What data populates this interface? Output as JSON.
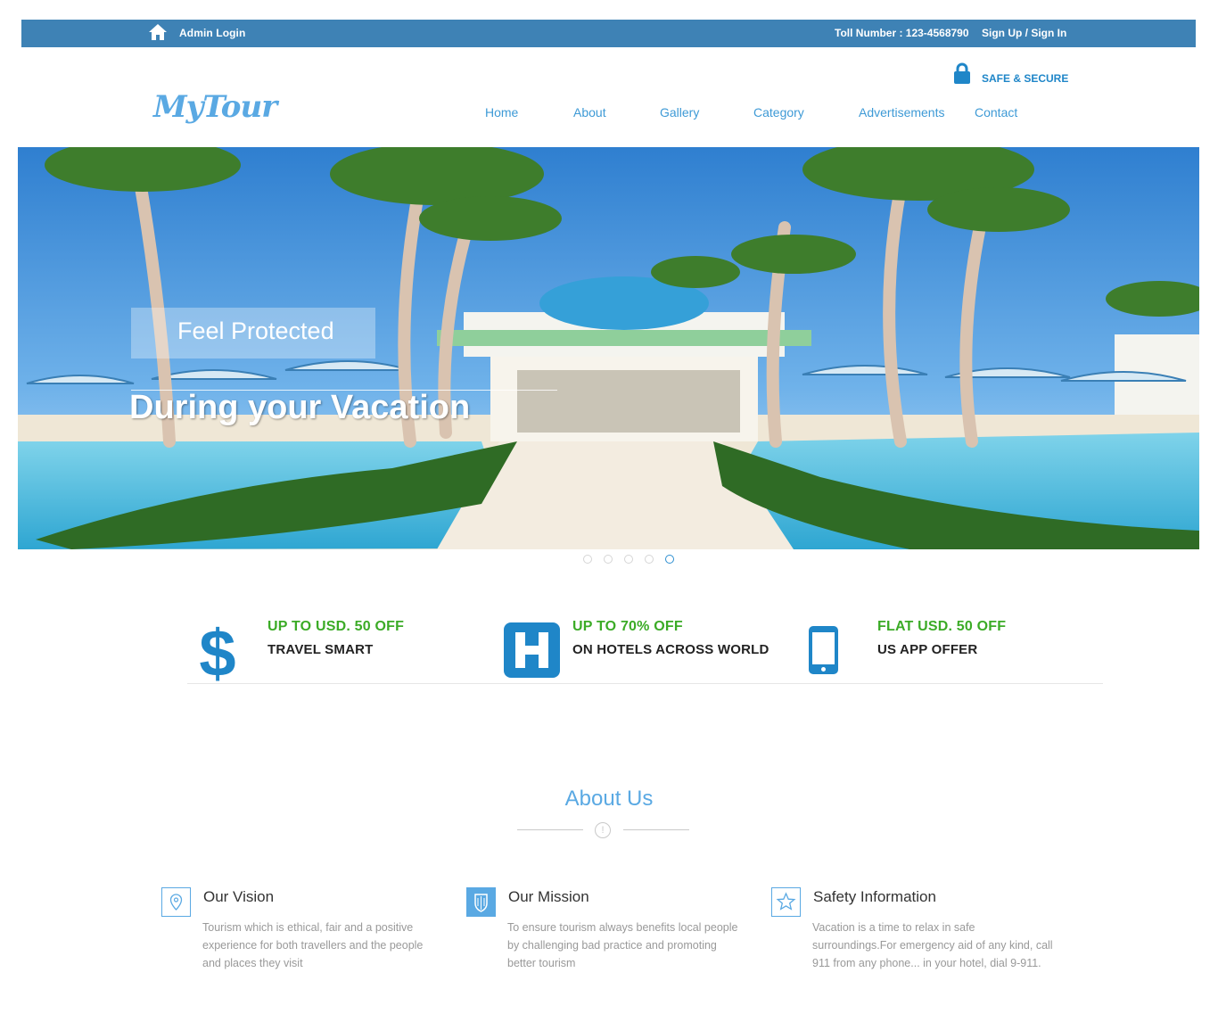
{
  "topbar": {
    "admin_label": "Admin Login",
    "toll": "Toll Number : 123-4568790",
    "sign": "Sign Up / Sign In",
    "bg_color": "#3e82b5"
  },
  "header": {
    "logo": "MyTour",
    "safe": "SAFE & SECURE",
    "nav": [
      "Home",
      "About",
      "Gallery",
      "Category",
      "Advertisements",
      "Contact"
    ]
  },
  "hero": {
    "caption_top": "Feel Protected",
    "caption_main": "During your Vacation",
    "slide_count": 5,
    "active_slide": 5
  },
  "offers": [
    {
      "title": "UP TO USD. 50 OFF",
      "subtitle": "TRAVEL SMART",
      "icon": "dollar-icon"
    },
    {
      "title": "UP TO 70% OFF",
      "subtitle": "ON HOTELS ACROSS WORLD",
      "icon": "hotel-icon"
    },
    {
      "title": "FLAT USD. 50 OFF",
      "subtitle": "US APP OFFER",
      "icon": "mobile-icon"
    }
  ],
  "about": {
    "title": "About Us",
    "features": [
      {
        "icon": "map-pin-icon",
        "heading": "Our Vision",
        "text": "Tourism which is ethical, fair and a positive experience for both travellers and the people and places they visit"
      },
      {
        "icon": "shield-icon",
        "heading": "Our Mission",
        "text": "To ensure tourism always benefits local people by challenging bad practice and promoting better tourism"
      },
      {
        "icon": "star-icon",
        "heading": "Safety Information",
        "text": "Vacation is a time to relax in safe surroundings.For emergency aid of any kind, call 911 from any phone... in your hotel, dial 9-911."
      }
    ]
  },
  "colors": {
    "accent": "#5aa9e3",
    "offer_green": "#3bab26",
    "icon_blue": "#1f86c8"
  }
}
